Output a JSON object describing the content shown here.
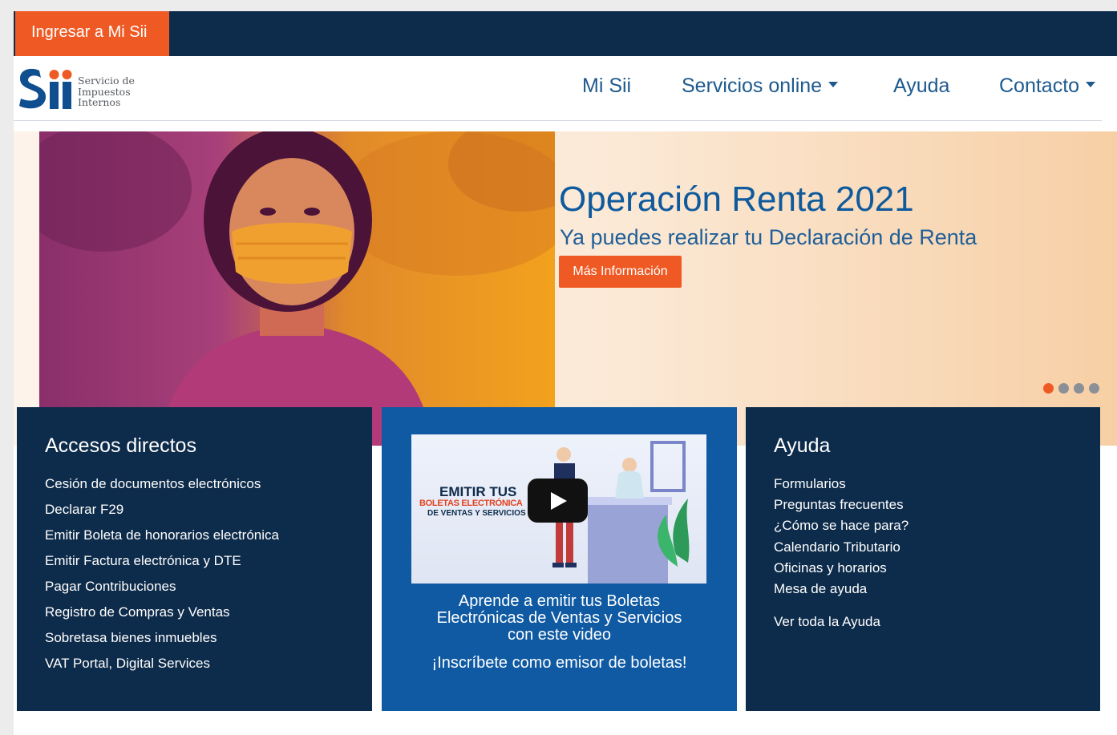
{
  "topbar": {
    "login_label": "Ingresar a Mi Sii"
  },
  "logo": {
    "mark": "sii",
    "line1": "Servicio de",
    "line2": "Impuestos",
    "line3": "Internos"
  },
  "nav": {
    "items": [
      {
        "label": "Mi Sii"
      },
      {
        "label": "Servicios online"
      },
      {
        "label": "Ayuda"
      },
      {
        "label": "Contacto"
      }
    ]
  },
  "hero": {
    "title": "Operación Renta 2021",
    "subtitle": "Ya puedes realizar tu Declaración de Renta",
    "button_label": "Más Información",
    "slide_count": 4,
    "active_slide": 1
  },
  "accesos": {
    "title": "Accesos directos",
    "links": [
      "Cesión de documentos electrónicos",
      "Declarar F29",
      "Emitir Boleta de honorarios electrónica",
      "Emitir Factura electrónica y DTE",
      "Pagar Contribuciones",
      "Registro de Compras y Ventas",
      "Sobretasa bienes inmuebles",
      "VAT Portal, Digital Services"
    ]
  },
  "video": {
    "thumb_title": "EMITIR TUS",
    "thumb_line2": "BOLETAS ELECTRÓNICA",
    "thumb_line3": "DE VENTAS Y SERVICIOS",
    "caption_line1": "Aprende a emitir tus  Boletas",
    "caption_line2": "Electrónicas de Ventas y Servicios",
    "caption_line3": "con este video",
    "cta": "¡Inscríbete como emisor de boletas!"
  },
  "ayuda": {
    "title": "Ayuda",
    "links": [
      "Formularios",
      "Preguntas frecuentes",
      "¿Cómo se hace para?",
      "Calendario Tributario",
      "Oficinas y horarios",
      "Mesa de ayuda"
    ],
    "all_label": "Ver toda la Ayuda"
  },
  "colors": {
    "navy": "#0d2b4a",
    "orange": "#ef5a24",
    "blue": "#0f5aa3",
    "link_blue": "#1d5a8e"
  }
}
